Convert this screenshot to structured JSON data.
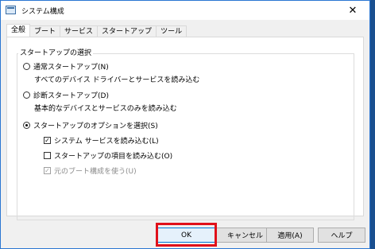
{
  "window": {
    "title": "システム構成",
    "close_glyph": "✕"
  },
  "tabs": [
    {
      "label": "全般",
      "active": true
    },
    {
      "label": "ブート",
      "active": false
    },
    {
      "label": "サービス",
      "active": false
    },
    {
      "label": "スタートアップ",
      "active": false
    },
    {
      "label": "ツール",
      "active": false
    }
  ],
  "startup_group": {
    "label": "スタートアップの選択",
    "normal": {
      "label": "通常スタートアップ(N)",
      "desc": "すべてのデバイス ドライバーとサービスを読み込む",
      "selected": false
    },
    "diagnostic": {
      "label": "診断スタートアップ(D)",
      "desc": "基本的なデバイスとサービスのみを読み込む",
      "selected": false
    },
    "selective": {
      "label": "スタートアップのオプションを選択(S)",
      "selected": true
    },
    "load_services": {
      "label": "システム サービスを読み込む(L)",
      "checked": true,
      "check_glyph": "✓"
    },
    "load_startup": {
      "label": "スタートアップの項目を読み込む(O)",
      "checked": false
    },
    "original_boot": {
      "label": "元のブート構成を使う(U)",
      "checked": true,
      "enabled": false,
      "check_glyph": "✓"
    }
  },
  "buttons": {
    "ok": "OK",
    "cancel": "キャンセル",
    "apply": "適用(A)",
    "help": "ヘルプ"
  },
  "colors": {
    "highlight": "#e0101a",
    "window_border": "#2b76d2",
    "desktop": "#1a4f8f"
  }
}
